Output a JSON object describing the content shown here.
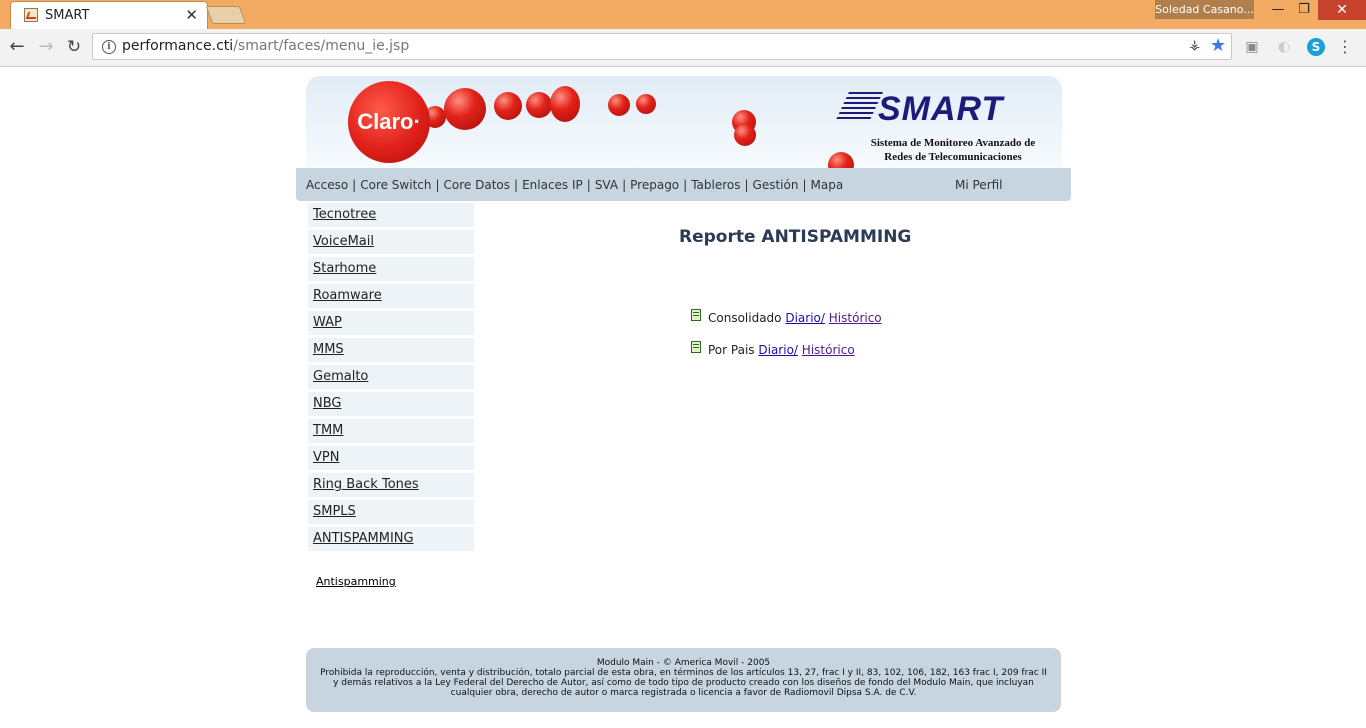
{
  "browser": {
    "tab_title": "SMART",
    "tab_close": "✕",
    "profile_name": "Soledad Casano...",
    "url_host": "performance.cti",
    "url_path": "/smart/faces/menu_ie.jsp"
  },
  "banner": {
    "claro_text": "Claro·",
    "small_claro": "Claro",
    "smart_logo": "SMART",
    "smart_subtitle_1": "Sistema de Monitoreo Avanzado de",
    "smart_subtitle_2": "Redes de Telecomunicaciones"
  },
  "menu": {
    "items": [
      "Acceso",
      "Core Switch",
      "Core Datos",
      "Enlaces IP",
      "SVA",
      "Prepago",
      "Tableros",
      "Gestión",
      "Mapa"
    ],
    "separator": "|",
    "profile": "Mi Perfil"
  },
  "sidebar": {
    "items": [
      "Tecnotree",
      "VoiceMail",
      "Starhome",
      "Roamware",
      "WAP",
      "MMS",
      "Gemalto",
      "NBG",
      "TMM",
      "VPN",
      "Ring Back Tones",
      "SMPLS",
      "ANTISPAMMING"
    ],
    "sub_link": "Antispamming"
  },
  "main": {
    "title": "Reporte ANTISPAMMING",
    "rows": [
      {
        "label": "Consolidado",
        "link1": "Diario/",
        "link2": "Histórico"
      },
      {
        "label": "Por Pais",
        "link1": "Diario/",
        "link2": "Histórico"
      }
    ]
  },
  "footer": {
    "line1": "Modulo Main - © America Movil - 2005",
    "line2": "Prohibida la reproducción, venta y distribución, totalo parcial de esta obra, en términos de los artículos 13, 27, frac I y II, 83, 102, 106, 182, 163 frac I, 209 frac II y demás relativos a la Ley Federal del Derecho de Autor, así como de todo tipo de producto creado con los diseños de fondo del Modulo Main, que incluyan cualquier obra, derecho de autor o marca registrada o licencia a favor de Radiomovil Dipsa S.A. de C.V."
  },
  "colors": {
    "titlebar": "#f3ab63",
    "menubar": "#c6d5e0",
    "claro_red": "#e2231a",
    "smart_blue": "#1d1a7a"
  }
}
